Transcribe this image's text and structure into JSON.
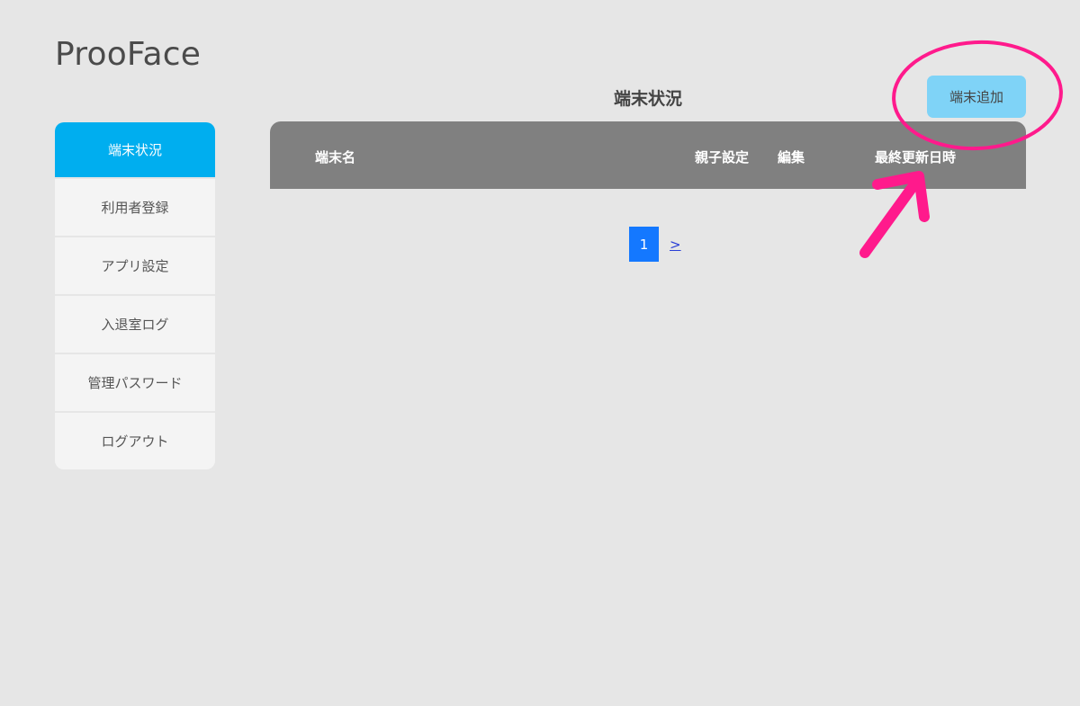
{
  "app": {
    "title": "ProoFace"
  },
  "sidebar": {
    "items": [
      {
        "label": "端末状況",
        "active": true
      },
      {
        "label": "利用者登録"
      },
      {
        "label": "アプリ設定"
      },
      {
        "label": "入退室ログ"
      },
      {
        "label": "管理パスワード"
      },
      {
        "label": "ログアウト"
      }
    ]
  },
  "main": {
    "title": "端末状況",
    "add_button_label": "端末追加",
    "table": {
      "columns": [
        "端末名",
        "親子設定",
        "編集",
        "最終更新日時"
      ],
      "rows": []
    },
    "pagination": {
      "current": "1",
      "next": ">"
    }
  },
  "colors": {
    "accent": "#00aeef",
    "add_button": "#7fd3f7",
    "table_header": "#808080",
    "page_current": "#1478ff",
    "annotation": "#ff1a8c"
  }
}
